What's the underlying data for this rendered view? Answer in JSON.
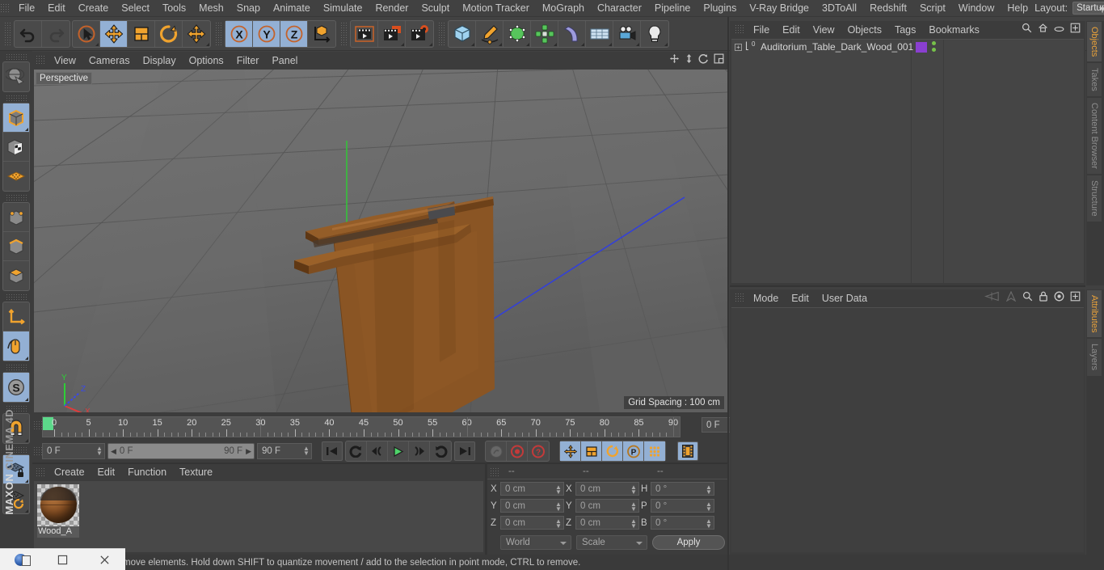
{
  "app": {
    "brand_maxon": "MAXON",
    "brand_product": "CINEMA 4D"
  },
  "menubar": {
    "items": [
      {
        "label": "File"
      },
      {
        "label": "Edit"
      },
      {
        "label": "Create"
      },
      {
        "label": "Select"
      },
      {
        "label": "Tools"
      },
      {
        "label": "Mesh"
      },
      {
        "label": "Snap"
      },
      {
        "label": "Animate"
      },
      {
        "label": "Simulate"
      },
      {
        "label": "Render"
      },
      {
        "label": "Sculpt"
      },
      {
        "label": "Motion Tracker"
      },
      {
        "label": "MoGraph"
      },
      {
        "label": "Character"
      },
      {
        "label": "Pipeline"
      },
      {
        "label": "Plugins"
      },
      {
        "label": "V-Ray Bridge"
      },
      {
        "label": "3DToAll"
      },
      {
        "label": "Redshift"
      },
      {
        "label": "Script"
      },
      {
        "label": "Window"
      },
      {
        "label": "Help"
      }
    ],
    "layout_label": "Layout:",
    "layout_value": "Startup",
    "search_icon": "search-icon"
  },
  "toolbar": {
    "undo": "undo-arrow-icon",
    "redo": "redo-arrow-icon",
    "live_selection": "live-selection-cursor-icon",
    "move": "move-arrows-icon",
    "scale": "scale-box-icon",
    "rotate": "rotate-circle-icon",
    "move_dup": "move-arrows-alt-icon",
    "axis_x": "X",
    "axis_y": "Y",
    "axis_z": "Z",
    "world_axis": "world-coordinate-icon",
    "render_view": "render-view-clapper-icon",
    "render_region": "render-region-clapper-icon",
    "render_settings": "render-settings-gear-clapper-icon",
    "cube": "primitive-cube-icon",
    "spline_pen": "spline-pen-icon",
    "nurbs": "generator-nurbs-icon",
    "array": "array-cluster-icon",
    "bend": "deformer-bend-icon",
    "floor": "environment-floor-icon",
    "camera": "camera-icon",
    "light": "light-bulb-icon"
  },
  "left_toolbar": {
    "items": [
      {
        "name": "make-editable-icon",
        "active": false
      },
      {
        "name": "model-mode-icon",
        "active": true
      },
      {
        "name": "texture-mode-icon",
        "active": false
      },
      {
        "name": "polygon-uv-mode-icon",
        "active": false
      },
      {
        "name": "point-mode-icon",
        "active": false
      },
      {
        "name": "edge-mode-icon",
        "active": false
      },
      {
        "name": "polygon-mode-icon",
        "active": false
      },
      {
        "name": "object-axis-mode-icon",
        "active": false
      },
      {
        "name": "enable-axis-mode-icon",
        "active": true
      },
      {
        "name": "soft-selection-icon",
        "active": true
      },
      {
        "name": "magnet-tool-icon",
        "active": false
      },
      {
        "name": "workplane-lock-icon",
        "active": true
      },
      {
        "name": "workplane-rotate-icon",
        "active": false
      }
    ]
  },
  "viewport": {
    "menu": [
      "View",
      "Cameras",
      "Display",
      "Options",
      "Filter",
      "Panel"
    ],
    "label": "Perspective",
    "grid_spacing": "Grid Spacing : 100 cm",
    "axis_x": "X",
    "axis_y": "Y",
    "axis_z": "Z",
    "nav_icons": [
      "viewport-move-icon",
      "viewport-scale-icon",
      "viewport-rotate-icon",
      "viewport-maximize-icon"
    ],
    "scene_object": "Auditorium table with dark wood desktop, back panel and metal pedestal base"
  },
  "timeline": {
    "ticks": [
      {
        "label": "0",
        "value": 0
      },
      {
        "label": "5",
        "value": 5
      },
      {
        "label": "10",
        "value": 10
      },
      {
        "label": "15",
        "value": 15
      },
      {
        "label": "20",
        "value": 20
      },
      {
        "label": "25",
        "value": 25
      },
      {
        "label": "30",
        "value": 30
      },
      {
        "label": "35",
        "value": 35
      },
      {
        "label": "40",
        "value": 40
      },
      {
        "label": "45",
        "value": 45
      },
      {
        "label": "50",
        "value": 50
      },
      {
        "label": "55",
        "value": 55
      },
      {
        "label": "60",
        "value": 60
      },
      {
        "label": "65",
        "value": 65
      },
      {
        "label": "70",
        "value": 70
      },
      {
        "label": "75",
        "value": 75
      },
      {
        "label": "80",
        "value": 80
      },
      {
        "label": "85",
        "value": 85
      },
      {
        "label": "90",
        "value": 90
      }
    ],
    "range_min": 0,
    "range_max": 90,
    "current_frame_top": "0 F",
    "current_frame": "0 F",
    "range_start": "0 F",
    "range_end": "90 F",
    "max_frame": "90 F",
    "transport": [
      {
        "name": "go-to-start-button",
        "glyph": "K"
      },
      {
        "name": "play-reverse-loop-button",
        "glyph": "C"
      },
      {
        "name": "previous-key-button",
        "glyph": "prev"
      },
      {
        "name": "play-button",
        "glyph": "play"
      },
      {
        "name": "next-key-button",
        "glyph": "next"
      },
      {
        "name": "play-forward-loop-button",
        "glyph": "D"
      },
      {
        "name": "go-to-end-button",
        "glyph": "end"
      }
    ],
    "record_tools": [
      {
        "name": "autokey-button",
        "active": false
      },
      {
        "name": "record-active-objects-button",
        "active": false
      },
      {
        "name": "keyframe-selection-button",
        "active": false
      }
    ],
    "key_toggles": [
      {
        "name": "position-key-toggle",
        "active": true
      },
      {
        "name": "scale-key-toggle",
        "active": true
      },
      {
        "name": "rotation-key-toggle",
        "active": true
      },
      {
        "name": "parameter-key-toggle",
        "active": true
      },
      {
        "name": "point-level-animation-toggle",
        "active": true
      }
    ],
    "timeline_toggle": {
      "name": "animation-mode-toggle",
      "active": true
    }
  },
  "material_manager": {
    "menu": [
      "Create",
      "Edit",
      "Function",
      "Texture"
    ],
    "materials": [
      {
        "name": "Wood_A",
        "label": "Wood_A"
      }
    ]
  },
  "coordinate_manager": {
    "header": [
      "--",
      "--",
      "--"
    ],
    "rows": [
      {
        "pos_label": "X",
        "pos_value": "0 cm",
        "size_label": "X",
        "size_value": "0 cm",
        "rot_label": "H",
        "rot_value": "0 °"
      },
      {
        "pos_label": "Y",
        "pos_value": "0 cm",
        "size_label": "Y",
        "size_value": "0 cm",
        "rot_label": "P",
        "rot_value": "0 °"
      },
      {
        "pos_label": "Z",
        "pos_value": "0 cm",
        "size_label": "Z",
        "size_value": "0 cm",
        "rot_label": "B",
        "rot_value": "0 °"
      }
    ],
    "system": "World",
    "mode": "Scale",
    "apply": "Apply"
  },
  "object_manager": {
    "menu": [
      "File",
      "Edit",
      "View",
      "Objects",
      "Tags",
      "Bookmarks"
    ],
    "right_icons": [
      "search-icon",
      "home-icon",
      "ellipse-icon",
      "expand-icon"
    ],
    "objects": [
      {
        "name": "Auditorium_Table_Dark_Wood_001",
        "level": 0,
        "tag": "0",
        "material_color": "#8a3fd0"
      }
    ]
  },
  "attribute_manager": {
    "menu": [
      "Mode",
      "Edit",
      "User Data"
    ],
    "right_icons": [
      "history-back-icon",
      "history-forward-icon",
      "search-icon",
      "lock-icon",
      "target-icon",
      "expand-icon"
    ]
  },
  "right_tabs": {
    "top": [
      {
        "label": "Objects",
        "selected": true
      },
      {
        "label": "Takes",
        "selected": false
      },
      {
        "label": "Content Browser",
        "selected": false
      },
      {
        "label": "Structure",
        "selected": false
      }
    ],
    "bottom": [
      {
        "label": "Attributes",
        "selected": true
      },
      {
        "label": "Layers",
        "selected": false
      }
    ]
  },
  "statusbar": {
    "text": "move elements. Hold down SHIFT to quantize movement / add to the selection in point mode, CTRL to remove."
  },
  "taskbar": {
    "logo": "cinema4d-logo-icon",
    "restore": "restore-window-icon",
    "close": "close-window-icon"
  },
  "colors": {
    "accent_orange": "#e8a13a",
    "panel_bg": "#3c3c3c",
    "toolbar_bg": "#424242",
    "active_blue": "#93b0d4",
    "wood": "#8a5124",
    "playhead_green": "#5cd98a"
  }
}
